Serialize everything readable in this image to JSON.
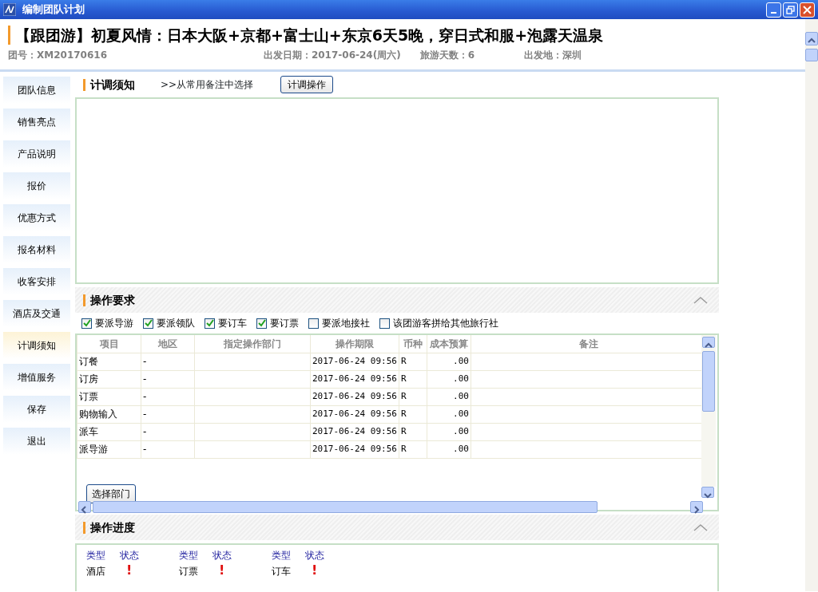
{
  "window": {
    "title": "编制团队计划"
  },
  "header": {
    "title": "【跟团游】初夏风情：日本大阪+京都+富士山+东京6天5晚，穿日式和服+泡露天温泉",
    "team_no": "团号：XM20170616",
    "depart_date": "出发日期：2017-06-24(周六)",
    "days": "旅游天数：6",
    "origin": "出发地：深圳"
  },
  "sidebar": {
    "items": [
      {
        "label": "团队信息",
        "selected": false
      },
      {
        "label": "销售亮点",
        "selected": false
      },
      {
        "label": "产品说明",
        "selected": false
      },
      {
        "label": "报价",
        "selected": false
      },
      {
        "label": "优惠方式",
        "selected": false
      },
      {
        "label": "报名材料",
        "selected": false
      },
      {
        "label": "收客安排",
        "selected": false
      },
      {
        "label": "酒店及交通",
        "selected": false
      },
      {
        "label": "计调须知",
        "selected": true
      },
      {
        "label": "增值服务",
        "selected": false
      },
      {
        "label": "保存",
        "selected": false
      },
      {
        "label": "退出",
        "selected": false
      }
    ]
  },
  "notice": {
    "heading": "计调须知",
    "link": ">>从常用备注中选择",
    "button": "计调操作"
  },
  "requirements": {
    "heading": "操作要求",
    "checkboxes": [
      {
        "label": "要派导游",
        "checked": true
      },
      {
        "label": "要派领队",
        "checked": true
      },
      {
        "label": "要订车",
        "checked": true
      },
      {
        "label": "要订票",
        "checked": true
      },
      {
        "label": "要派地接社",
        "checked": false
      },
      {
        "label": "该团游客拼给其他旅行社",
        "checked": false
      }
    ],
    "table": {
      "columns": [
        "项目",
        "地区",
        "指定操作部门",
        "操作期限",
        "币种",
        "成本预算",
        "备注"
      ],
      "rows": [
        [
          "订餐",
          "-",
          "",
          "2017-06-24 09:56",
          "R",
          ".00",
          ""
        ],
        [
          "订房",
          "-",
          "",
          "2017-06-24 09:56",
          "R",
          ".00",
          ""
        ],
        [
          "订票",
          "-",
          "",
          "2017-06-24 09:56",
          "R",
          ".00",
          ""
        ],
        [
          "购物输入",
          "-",
          "",
          "2017-06-24 09:56",
          "R",
          ".00",
          ""
        ],
        [
          "派车",
          "-",
          "",
          "2017-06-24 09:56",
          "R",
          ".00",
          ""
        ],
        [
          "派导游",
          "-",
          "",
          "2017-06-24 09:56",
          "R",
          ".00",
          ""
        ]
      ]
    },
    "button": "选择部门"
  },
  "progress": {
    "heading": "操作进度",
    "groups": [
      {
        "type_label": "类型",
        "status_label": "状态",
        "type": "酒店",
        "status": "!"
      },
      {
        "type_label": "类型",
        "status_label": "状态",
        "type": "订票",
        "status": "!"
      },
      {
        "type_label": "类型",
        "status_label": "状态",
        "type": "订车",
        "status": "!"
      }
    ]
  }
}
